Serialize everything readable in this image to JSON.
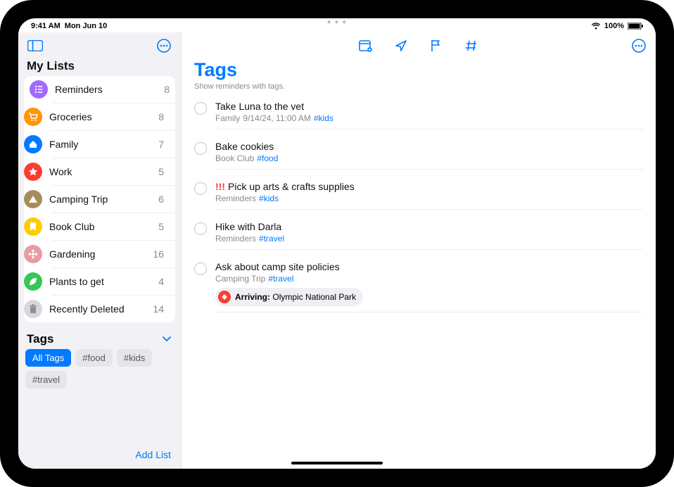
{
  "statusbar": {
    "time": "9:41 AM",
    "date": "Mon Jun 10",
    "battery": "100%"
  },
  "sidebar": {
    "title": "My Lists",
    "lists": [
      {
        "name": "Reminders",
        "count": "8",
        "color": "#a06bff",
        "icon": "list"
      },
      {
        "name": "Groceries",
        "count": "8",
        "color": "#ff9500",
        "icon": "cart"
      },
      {
        "name": "Family",
        "count": "7",
        "color": "#007aff",
        "icon": "house"
      },
      {
        "name": "Work",
        "count": "5",
        "color": "#ff3b30",
        "icon": "star"
      },
      {
        "name": "Camping Trip",
        "count": "6",
        "color": "#a88d5a",
        "icon": "tent"
      },
      {
        "name": "Book Club",
        "count": "5",
        "color": "#ffcc00",
        "icon": "bookmark"
      },
      {
        "name": "Gardening",
        "count": "16",
        "color": "#e89ba2",
        "icon": "flower"
      },
      {
        "name": "Plants to get",
        "count": "4",
        "color": "#34c759",
        "icon": "leaf"
      },
      {
        "name": "Recently Deleted",
        "count": "14",
        "color": "#d8d8dc",
        "icon": "trash"
      }
    ],
    "tags_title": "Tags",
    "tags": [
      {
        "label": "All Tags",
        "active": true
      },
      {
        "label": "#food",
        "active": false
      },
      {
        "label": "#kids",
        "active": false
      },
      {
        "label": "#travel",
        "active": false
      }
    ],
    "add_list": "Add List"
  },
  "main": {
    "title": "Tags",
    "subtitle": "Show reminders with tags.",
    "reminders": [
      {
        "title": "Take Luna to the vet",
        "list": "Family",
        "detail": "9/14/24, 11:00 AM",
        "tag": "#kids",
        "priority": ""
      },
      {
        "title": "Bake cookies",
        "list": "Book Club",
        "detail": "",
        "tag": "#food",
        "priority": ""
      },
      {
        "title": "Pick up arts & crafts supplies",
        "list": "Reminders",
        "detail": "",
        "tag": "#kids",
        "priority": "!!!"
      },
      {
        "title": "Hike with Darla",
        "list": "Reminders",
        "detail": "",
        "tag": "#travel",
        "priority": ""
      },
      {
        "title": "Ask about camp site policies",
        "list": "Camping Trip",
        "detail": "",
        "tag": "#travel",
        "priority": "",
        "location_label": "Arriving:",
        "location_name": "Olympic National Park"
      }
    ]
  }
}
